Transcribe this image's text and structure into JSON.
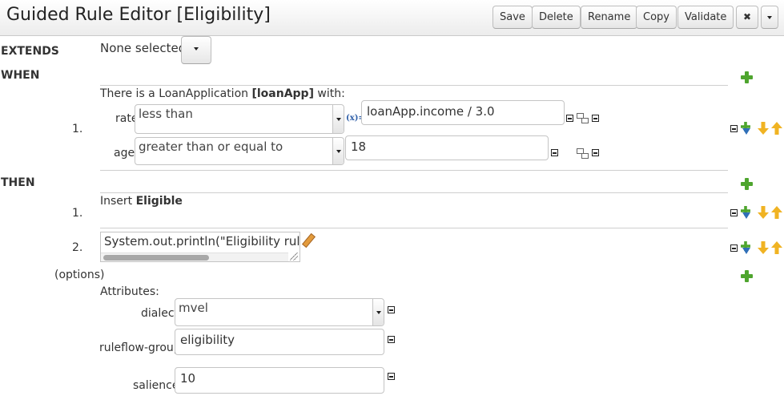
{
  "header": {
    "title": "Guided Rule Editor [Eligibility]",
    "buttons": {
      "save": "Save",
      "delete": "Delete",
      "rename": "Rename",
      "copy": "Copy",
      "validate": "Validate",
      "close": "✖"
    }
  },
  "extends": {
    "label": "EXTENDS",
    "value": "None selected"
  },
  "when": {
    "label": "WHEN",
    "rule_number": "1.",
    "pattern_prefix": "There is a LoanApplication ",
    "pattern_binding": "[loanApp]",
    "pattern_suffix": " with:",
    "constraints": [
      {
        "field": "rate",
        "operator": "less than",
        "fx": "(x)=",
        "value": "loanApp.income / 3.0"
      },
      {
        "field": "age",
        "operator": "greater than or equal to",
        "value": "18"
      }
    ]
  },
  "then": {
    "label": "THEN",
    "actions": [
      {
        "number": "1.",
        "prefix": "Insert ",
        "fact": "Eligible"
      },
      {
        "number": "2.",
        "code": "System.out.println(\"Eligibility rule: A"
      }
    ]
  },
  "options": {
    "label": "(options)",
    "attributes_label": "Attributes:",
    "attributes": [
      {
        "name": "dialect",
        "value": "mvel"
      },
      {
        "name": "ruleflow-group",
        "value": "eligibility"
      },
      {
        "name": "salience",
        "value": "10"
      }
    ]
  },
  "icons": {
    "add": "plus-icon",
    "remove": "minus-icon",
    "insert": "insert-icon",
    "move_down": "arrow-down-icon",
    "move_up": "arrow-up-icon",
    "edit": "pencil-icon",
    "expand": "expand-icon"
  },
  "colors": {
    "add_green": "#4ea52e",
    "move_orange": "#f0b323",
    "insert_blue": "#2f6fb8"
  }
}
